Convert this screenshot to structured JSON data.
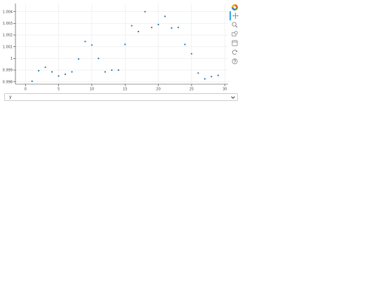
{
  "chart_data": {
    "type": "scatter",
    "title": "",
    "xlabel": "",
    "ylabel": "",
    "xlim": [
      -1.5,
      30.5
    ],
    "ylim": [
      0.9978,
      1.0047
    ],
    "x_ticks": [
      0,
      5,
      10,
      15,
      20,
      25,
      30
    ],
    "y_ticks": [
      0.998,
      0.999,
      1,
      1.001,
      1.002,
      1.003,
      1.004
    ],
    "y_tick_labels": [
      "0.998",
      "0.999",
      "1",
      "1.001",
      "1.002",
      "1.003",
      "1.004"
    ],
    "grid": true,
    "marker_color": "#1f77b4",
    "x": [
      1,
      2,
      3,
      4,
      5,
      6,
      7,
      8,
      9,
      10,
      11,
      12,
      13,
      14,
      15,
      16,
      17,
      18,
      19,
      20,
      21,
      22,
      23,
      24,
      25,
      26,
      27,
      28,
      29
    ],
    "y": [
      0.99805,
      0.99895,
      0.99925,
      0.99885,
      0.9985,
      0.99865,
      0.99885,
      0.99995,
      1.00145,
      1.00115,
      1.0,
      0.99885,
      0.999,
      0.999,
      1.0012,
      1.0028,
      1.0023,
      1.004,
      1.00265,
      1.0029,
      1.0036,
      1.0026,
      1.00265,
      1.0012,
      1.0004,
      0.99875,
      0.99825,
      0.99845,
      0.99855
    ]
  },
  "toolbar": {
    "tools": [
      "bokeh-logo-icon",
      "pan-icon",
      "box-zoom-icon",
      "wheel-zoom-icon",
      "save-icon",
      "reset-icon",
      "help-icon"
    ]
  },
  "selector": {
    "value": "y"
  }
}
